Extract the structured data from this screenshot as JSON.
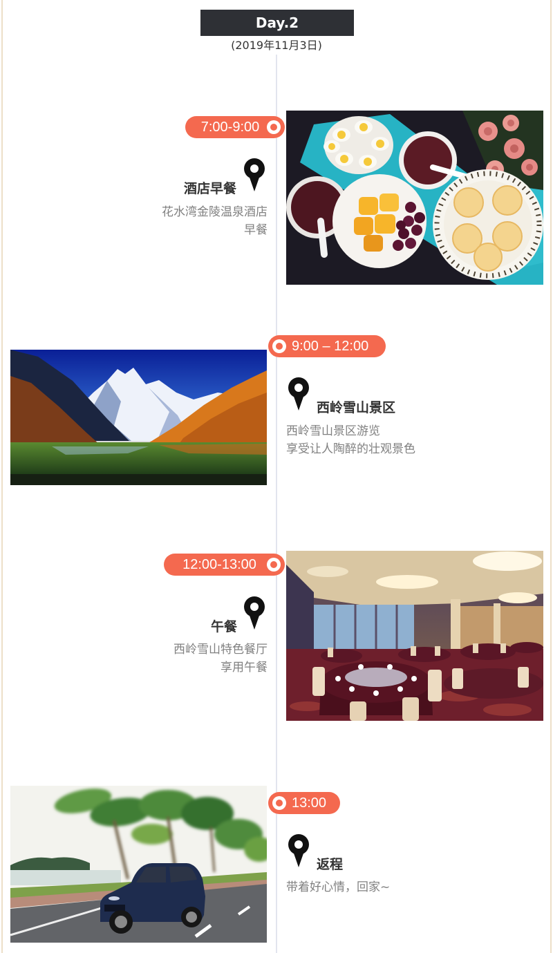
{
  "day": {
    "label": "Day.2",
    "date": "(2019年11月3日)"
  },
  "schedule": [
    {
      "time": "7:00-9:00",
      "title": "酒店早餐",
      "lines": [
        "花水湾金陵温泉酒店",
        "早餐"
      ]
    },
    {
      "time": "9:00 – 12:00",
      "title": "西岭雪山景区",
      "lines": [
        "西岭雪山景区游览",
        "享受让人陶醉的壮观景色"
      ]
    },
    {
      "time": "12:00-13:00",
      "title": "午餐",
      "lines": [
        "西岭雪山特色餐厅",
        "享用午餐"
      ]
    },
    {
      "time": "13:00",
      "title": "返程",
      "lines": [
        "带着好心情，回家~"
      ]
    }
  ],
  "icons": {
    "location": "map-pin-icon",
    "time": "time-dot-icon"
  },
  "colors": {
    "accent": "#f4694f",
    "banner": "#2e3035",
    "timeline": "#e2e5ee",
    "title_text": "#333333",
    "desc_text": "#808080",
    "frame": "#ecdfc8"
  }
}
